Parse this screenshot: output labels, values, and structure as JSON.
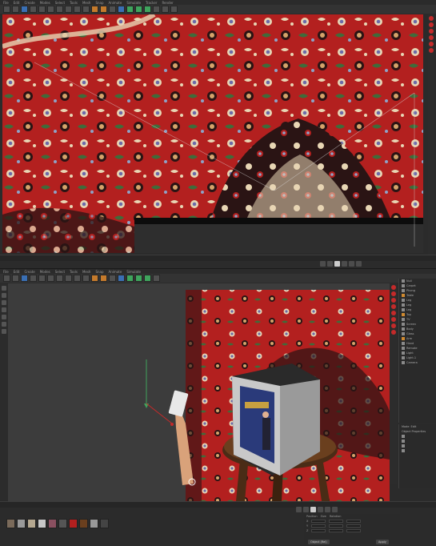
{
  "top_menu": {
    "items": [
      "File",
      "Edit",
      "Create",
      "Modes",
      "Select",
      "Tools",
      "Mesh",
      "Snap",
      "Animate",
      "Simulate",
      "Tracker",
      "Render",
      "Sculpt",
      "MoGraph",
      "Character",
      "Pipeline",
      "Plugins",
      "Script",
      "Window",
      "Help"
    ]
  },
  "bottom_menu": {
    "items": [
      "File",
      "Edit",
      "Create",
      "Modes",
      "Select",
      "Tools",
      "Mesh",
      "Snap",
      "Animate",
      "Simulate",
      "Tracker",
      "Render",
      "Sculpt",
      "MoGraph"
    ]
  },
  "object_manager": {
    "header_tabs": [
      "File",
      "Edit",
      "View",
      "Objects",
      "Tags"
    ],
    "rows": [
      "Null",
      "Carpet",
      "Phong",
      "Table",
      "Leg",
      "Leg",
      "Leg",
      "Top",
      "TV",
      "Screen",
      "Body",
      "Glass",
      "Arm",
      "Hand",
      "Remote",
      "Light",
      "Light.1",
      "Camera",
      "Floor",
      "Sky",
      "Background",
      "Environment"
    ],
    "attr_tabs": [
      "Mode",
      "Edit",
      "User Data"
    ],
    "attr_section": "Object Properties"
  },
  "coordinates": {
    "labels": [
      "Position",
      "Size",
      "Rotation"
    ],
    "axis": [
      "X",
      "Y",
      "Z"
    ],
    "apply_label": "Apply",
    "mode_label": "Object (Rel)",
    "size_mode": "Size"
  },
  "colors": {
    "accent_blue": "#3a6fb3",
    "accent_green": "#3fa45d",
    "rug_red": "#b3201f",
    "rug_dark": "#2a1414",
    "rug_cream": "#e8d6b4",
    "viewport_bg": "#3b3b3b"
  },
  "icons": {
    "move": "move-icon",
    "scale": "scale-icon",
    "rotate": "rotate-icon",
    "render": "render-icon",
    "play": "play-icon"
  }
}
